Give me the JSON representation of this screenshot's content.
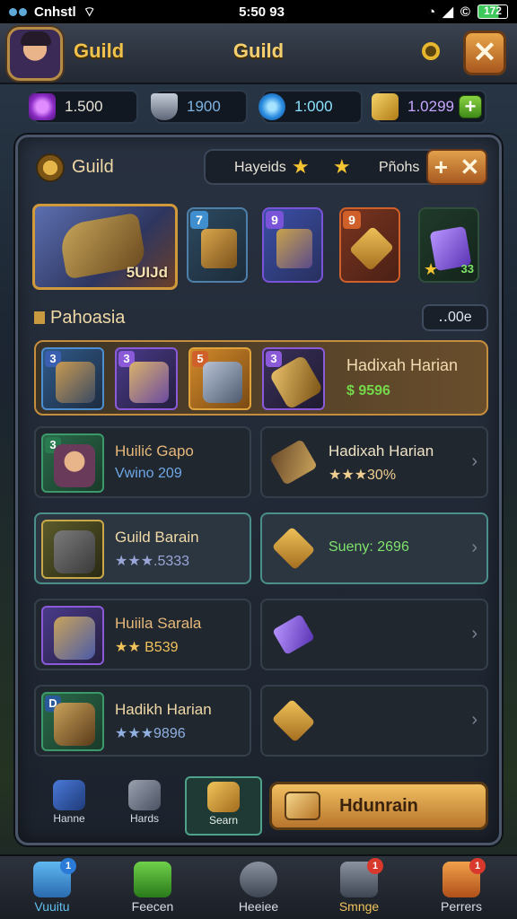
{
  "status": {
    "carrier": "Cnhstl",
    "time": "5:50 93",
    "battery": "172"
  },
  "topbar": {
    "title_left": "Guild",
    "title_center": "Guild",
    "close_label": "✕"
  },
  "resources": [
    {
      "value": "1.500",
      "color": "#b24be0"
    },
    {
      "value": "1900",
      "color": "#8f9bb0"
    },
    {
      "value": "1:000",
      "color": "#3aa0e8"
    },
    {
      "value": "1.0299",
      "color": "#d9a12e",
      "plus": "+"
    }
  ],
  "panel": {
    "tab_title": "Guild",
    "tabs": {
      "first": "Hayeids",
      "second": "Pñohs",
      "plus": "+",
      "close": "✕"
    },
    "featured_label": "5UIJd",
    "cards": [
      {
        "level": "7",
        "level_color": "#3f8fcf"
      },
      {
        "level": "9",
        "level_color": "#7a54d8"
      },
      {
        "level": "9",
        "level_color": "#d0602a"
      },
      {
        "level": "",
        "badge": "33"
      }
    ],
    "section_title": "Pahoasia",
    "section_pill": "‥00e",
    "main_row": {
      "levels": [
        "3",
        "3",
        "5",
        "3"
      ],
      "name": "Hadixah Harian",
      "sub": "$ 9596"
    },
    "rows": [
      {
        "level": "3",
        "left_name": "Huilić Gapo",
        "left_sub": "Vwino 209",
        "right_name": "Hadixah Harian",
        "right_sub": "★★★30%"
      },
      {
        "level": "",
        "left_name": "Guild Barain",
        "left_sub": "★★★.5333",
        "right_name": "",
        "right_sub": "Sueny: 2696"
      },
      {
        "level": "",
        "left_name": "Huiila Sarala",
        "left_sub": "★★ B539",
        "right_name": "",
        "right_sub": ""
      },
      {
        "level": "D",
        "left_name": "Hadikh Harian",
        "left_sub": "★★★9896",
        "right_name": "",
        "right_sub": ""
      }
    ],
    "actions": [
      {
        "label": "Hanne"
      },
      {
        "label": "Hards"
      },
      {
        "label": "Searn"
      }
    ],
    "big_button": "Hdunrain"
  },
  "nav": [
    {
      "label": "Vuuitu",
      "badge": "1"
    },
    {
      "label": "Feecen",
      "badge": ""
    },
    {
      "label": "Heeiee",
      "badge": ""
    },
    {
      "label": "Smnge",
      "badge": "1"
    },
    {
      "label": "Perrers",
      "badge": "1"
    }
  ],
  "chevron": "›"
}
